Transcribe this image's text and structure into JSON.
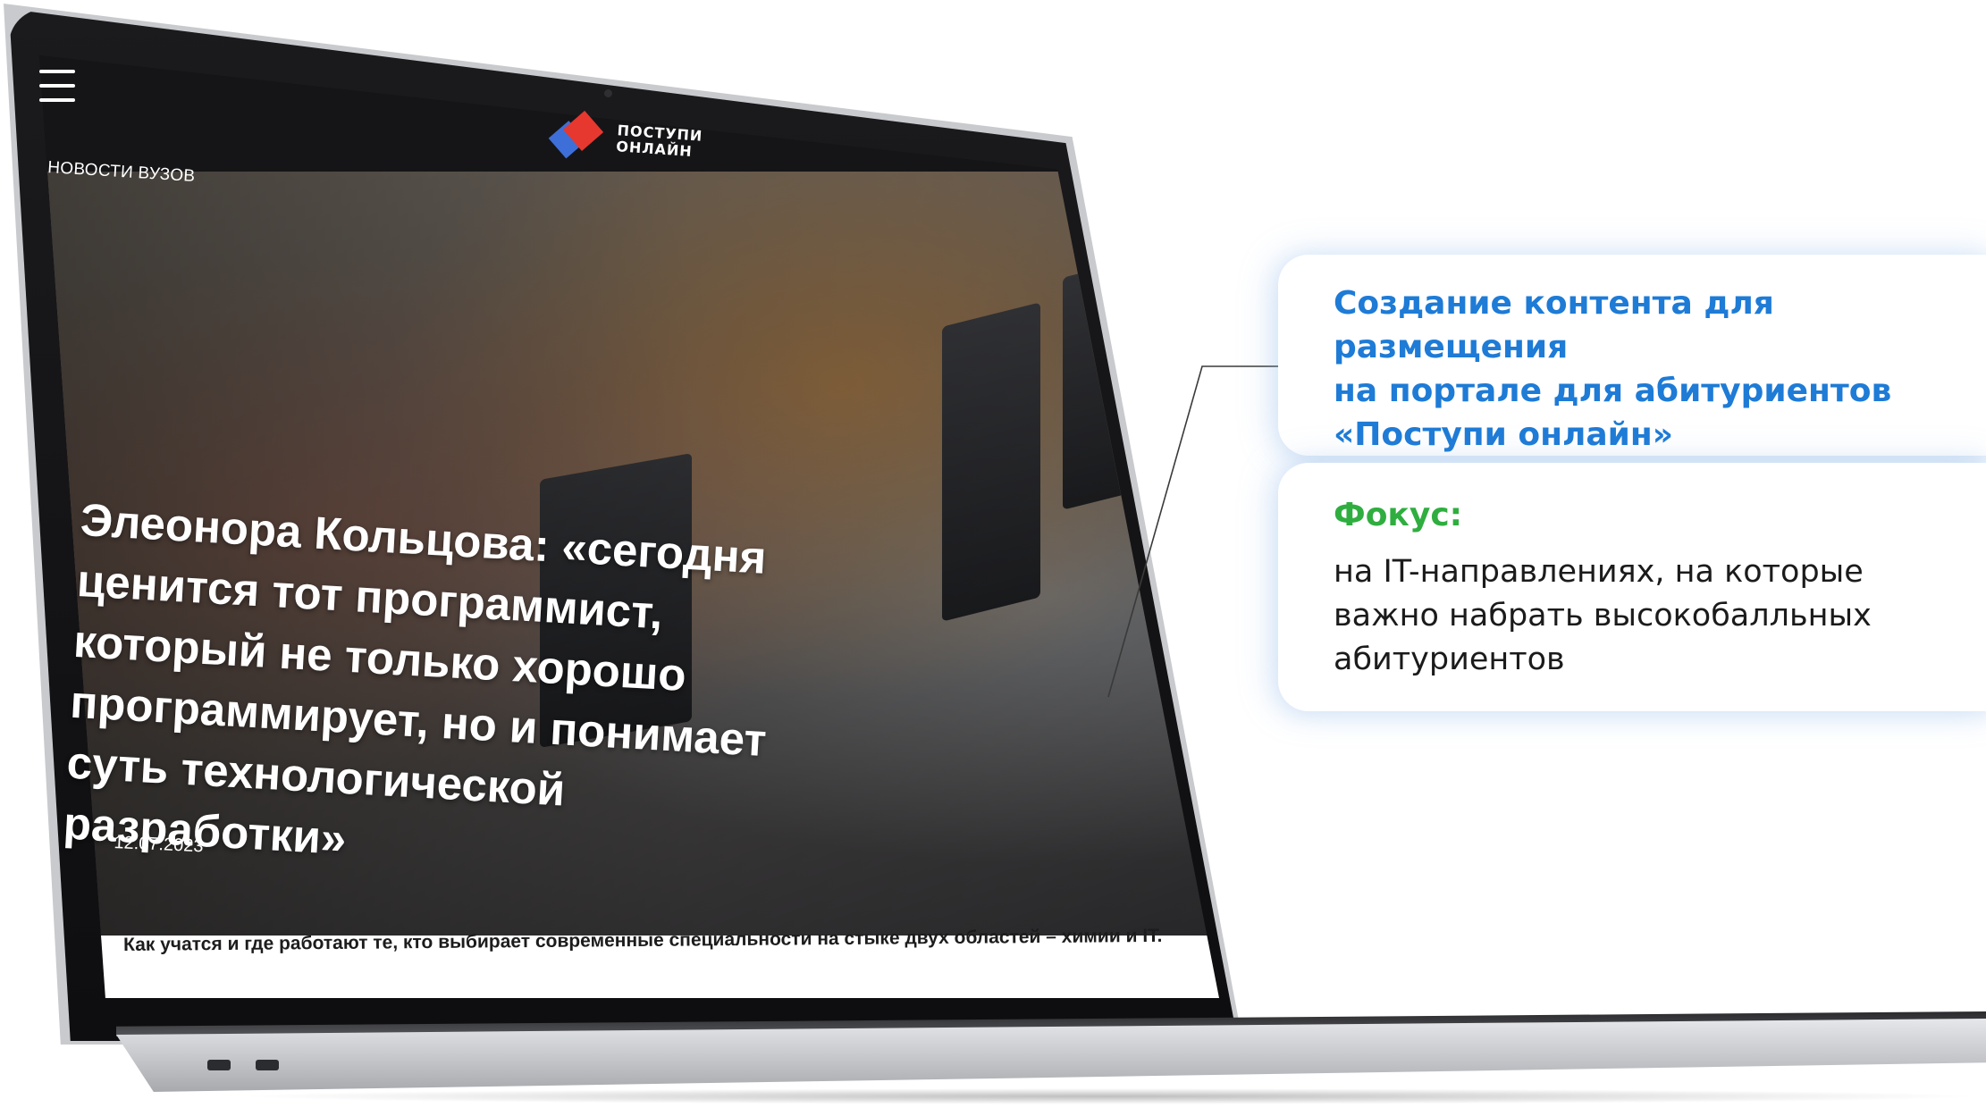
{
  "site": {
    "logo_line_1": "ПОСТУПИ",
    "logo_line_2": "ОНЛАЙН",
    "section_label": "НОВОСТИ ВУЗОВ"
  },
  "article": {
    "headline": "Элеонора Кольцова: «сегодня ценится тот программист, который не только хорошо программирует, но и понимает суть технологической разработки»",
    "date": "12.07.2023",
    "lede": "Как учатся и где работают те, кто выбирает современные специальности на стыке двух областей – химии и IT."
  },
  "cards": {
    "title": "Создание контента для размещения\nна портале для абитуриентов\n«Поступи онлайн»",
    "focus_label": "Фокус:",
    "focus_text": "на IT-направлениях, на которые\nважно набрать высокобалльных\nабитуриентов"
  },
  "icons": {
    "menu": "hamburger-menu-icon",
    "share": "share-icon",
    "logo": "postupi-online-logo"
  },
  "colors": {
    "title_blue": "#1e7bd6",
    "focus_green": "#2fae3f",
    "logo_red": "#e6382f",
    "logo_blue": "#3e6fd8"
  }
}
